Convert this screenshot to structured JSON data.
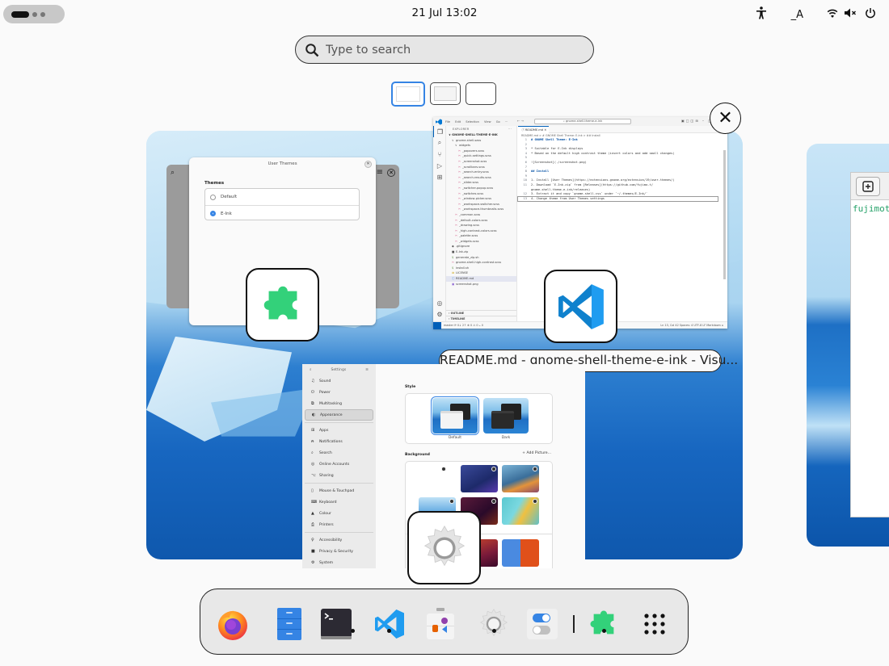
{
  "topbar": {
    "clock": "21 Jul  13:02",
    "tray": {
      "accessibility_icon": "accessibility-icon",
      "input_method": "_A",
      "wifi_icon": "wifi-icon",
      "volume_icon": "volume-muted-icon",
      "power_icon": "power-icon"
    }
  },
  "search": {
    "placeholder": "Type to search",
    "value": ""
  },
  "workspaces": {
    "count": 3,
    "active_index": 0
  },
  "windows": {
    "user_themes": {
      "title": "User Themes",
      "section_label": "Themes",
      "options": [
        {
          "label": "Default",
          "selected": false
        },
        {
          "label": "E-Ink",
          "selected": true
        }
      ],
      "app_icon": "extensions-puzzle-icon"
    },
    "vscode": {
      "window_caption": "README.md - gnome-shell-theme-e-ink - Visu...",
      "menu": [
        "File",
        "Edit",
        "Selection",
        "View",
        "Go",
        "···"
      ],
      "command_center": "⌕ gnome-shell-theme-e-ink",
      "explorer_header": "EXPLORER",
      "project_root": "GNOME-SHELL-THEME-E-INK",
      "tree": [
        {
          "name": "gnome-shell-sass",
          "depth": 1,
          "type": "folder"
        },
        {
          "name": "widgets",
          "depth": 2,
          "type": "folder"
        },
        {
          "name": "_popovers.scss",
          "depth": 3,
          "type": "scss"
        },
        {
          "name": "_quick-settings.scss",
          "depth": 3,
          "type": "scss"
        },
        {
          "name": "_screenshot.scss",
          "depth": 3,
          "type": "scss"
        },
        {
          "name": "_scrollbars.scss",
          "depth": 3,
          "type": "scss"
        },
        {
          "name": "_search-entry.scss",
          "depth": 3,
          "type": "scss"
        },
        {
          "name": "_search-results.scss",
          "depth": 3,
          "type": "scss"
        },
        {
          "name": "_slider.scss",
          "depth": 3,
          "type": "scss"
        },
        {
          "name": "_switcher-popup.scss",
          "depth": 3,
          "type": "scss"
        },
        {
          "name": "_switches.scss",
          "depth": 3,
          "type": "scss"
        },
        {
          "name": "_window-picker.scss",
          "depth": 3,
          "type": "scss"
        },
        {
          "name": "_workspace-switcher.scss",
          "depth": 3,
          "type": "scss"
        },
        {
          "name": "_workspace-thumbnails.scss",
          "depth": 3,
          "type": "scss"
        },
        {
          "name": "_common.scss",
          "depth": 2,
          "type": "scss"
        },
        {
          "name": "_default-colors.scss",
          "depth": 2,
          "type": "scss"
        },
        {
          "name": "_drawing.scss",
          "depth": 2,
          "type": "scss"
        },
        {
          "name": "_high-contrast-colors.scss",
          "depth": 2,
          "type": "scss"
        },
        {
          "name": "_palette.scss",
          "depth": 2,
          "type": "scss"
        },
        {
          "name": "_widgets.scss",
          "depth": 2,
          "type": "scss"
        },
        {
          "name": ".gitignore",
          "depth": 1,
          "type": "git"
        },
        {
          "name": "E-Ink.zip",
          "depth": 1,
          "type": "zip"
        },
        {
          "name": "generate_zip.sh",
          "depth": 1,
          "type": "sh"
        },
        {
          "name": "gnome-shell-high-contrast.scss",
          "depth": 1,
          "type": "scss"
        },
        {
          "name": "install.sh",
          "depth": 1,
          "type": "sh"
        },
        {
          "name": "LICENSE",
          "depth": 1,
          "type": "license"
        },
        {
          "name": "README.md",
          "depth": 1,
          "type": "md",
          "selected": true
        },
        {
          "name": "screenshot.png",
          "depth": 1,
          "type": "png"
        }
      ],
      "outline_label": "OUTLINE",
      "timeline_label": "TIMELINE",
      "tab_label": "README.md",
      "breadcrumb": "README.md > # GNOME Shell Theme: E-Ink > ## Install",
      "code_lines": [
        {
          "n": "1",
          "text": "# GNOME Shell Theme: E-Ink",
          "heading": true
        },
        {
          "n": "2",
          "text": ""
        },
        {
          "n": "3",
          "text": "* Suitable for E-Ink displays"
        },
        {
          "n": "4",
          "text": "* Based on the default high contrast theme (invert colors and add small changes)"
        },
        {
          "n": "5",
          "text": ""
        },
        {
          "n": "6",
          "text": "![Screenshot](./screenshot.png)"
        },
        {
          "n": "7",
          "text": ""
        },
        {
          "n": "8",
          "text": "## Install",
          "heading": true
        },
        {
          "n": "9",
          "text": ""
        },
        {
          "n": "10",
          "text": "1. Install [User Themes](https://extensions.gnome.org/extension/19/user-themes/)"
        },
        {
          "n": "11",
          "text": "2. Download `E-Ink.zip` from [Releases](https://github.com/fujimo-t/"
        },
        {
          "n": "",
          "text": "gnome-shell-theme-e-ink/releases)"
        },
        {
          "n": "12",
          "text": "3. Extract it and copy `gnome-shell.css` under `~/.themes/E-Ink/`"
        },
        {
          "n": "13",
          "text": "4. Change theme from User Themes settings",
          "current": true
        }
      ],
      "status_left": "master  ⟳ 0↓ 2↑   ⊗ 0 ⚠ 0   ⫠ 0",
      "status_right": "Ln 13, Col 42   Spaces: 4   UTF-8   LF   Markdown  ⌂",
      "app_icon": "vscode-icon"
    },
    "settings": {
      "header_title": "Settings",
      "sidebar": [
        {
          "label": "Sound",
          "icon": "sound-icon"
        },
        {
          "label": "Power",
          "icon": "power-icon"
        },
        {
          "label": "Multitasking",
          "icon": "multitasking-icon"
        },
        {
          "label": "Appearance",
          "icon": "appearance-icon",
          "selected": true
        },
        {
          "sep": true
        },
        {
          "label": "Apps",
          "icon": "apps-icon"
        },
        {
          "label": "Notifications",
          "icon": "bell-icon"
        },
        {
          "label": "Search",
          "icon": "search-icon"
        },
        {
          "label": "Online Accounts",
          "icon": "online-accounts-icon"
        },
        {
          "label": "Sharing",
          "icon": "sharing-icon"
        },
        {
          "sep": true
        },
        {
          "label": "Mouse & Touchpad",
          "icon": "mouse-icon"
        },
        {
          "label": "Keyboard",
          "icon": "keyboard-icon"
        },
        {
          "label": "Colour",
          "icon": "colour-icon"
        },
        {
          "label": "Printers",
          "icon": "printer-icon"
        },
        {
          "sep": true
        },
        {
          "label": "Accessibility",
          "icon": "accessibility-icon"
        },
        {
          "label": "Privacy & Security",
          "icon": "privacy-icon"
        },
        {
          "label": "System",
          "icon": "system-icon"
        }
      ],
      "style_label": "Style",
      "style_options": [
        {
          "label": "Default",
          "selected": true
        },
        {
          "label": "Dark",
          "selected": false
        }
      ],
      "background_label": "Background",
      "add_picture_label": "+ Add Picture...",
      "app_icon": "settings-gear-icon"
    },
    "terminal": {
      "prompt_text": "fujimot"
    }
  },
  "close_button_label": "✕",
  "dock": {
    "items": [
      {
        "name": "Firefox",
        "icon": "firefox-icon",
        "running": false
      },
      {
        "name": "Files",
        "icon": "files-icon",
        "running": false
      },
      {
        "name": "Terminal",
        "icon": "terminal-icon",
        "running": true
      },
      {
        "name": "Visual Studio Code",
        "icon": "vscode-icon",
        "running": true
      },
      {
        "name": "Software",
        "icon": "software-icon",
        "running": false
      },
      {
        "name": "Settings",
        "icon": "settings-gear-icon",
        "running": true
      },
      {
        "name": "Tweaks",
        "icon": "tweaks-icon",
        "running": false
      },
      {
        "name": "Extensions",
        "icon": "extensions-puzzle-icon",
        "running": true
      },
      {
        "name": "Show Apps",
        "icon": "app-grid-icon",
        "running": false
      }
    ]
  },
  "colors": {
    "accent": "#3584e4",
    "puzzle_green": "#33d17a",
    "vscode_blue": "#007acc",
    "terminal_green": "#26a269"
  }
}
